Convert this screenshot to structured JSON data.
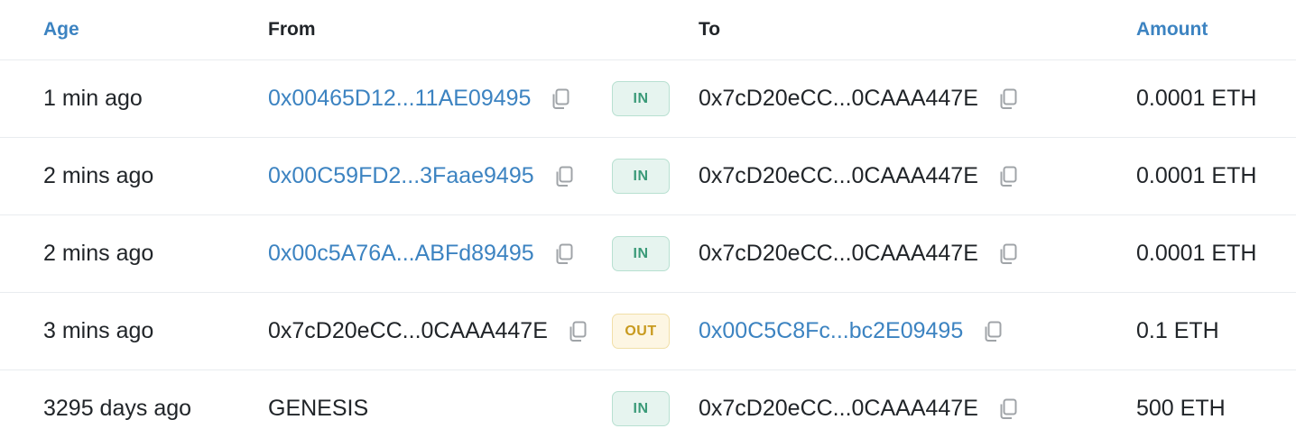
{
  "header": {
    "age": "Age",
    "from": "From",
    "to": "To",
    "amount": "Amount"
  },
  "rows": [
    {
      "age": "1 min ago",
      "from": "0x00465D12...11AE09495",
      "direction": "IN",
      "to": "0x7cD20eCC...0CAAA447E",
      "amount": "0.0001 ETH"
    },
    {
      "age": "2 mins ago",
      "from": "0x00C59FD2...3Faae9495",
      "direction": "IN",
      "to": "0x7cD20eCC...0CAAA447E",
      "amount": "0.0001 ETH"
    },
    {
      "age": "2 mins ago",
      "from": "0x00c5A76A...ABFd89495",
      "direction": "IN",
      "to": "0x7cD20eCC...0CAAA447E",
      "amount": "0.0001 ETH"
    },
    {
      "age": "3 mins ago",
      "from": "0x7cD20eCC...0CAAA447E",
      "direction": "OUT",
      "to": "0x00C5C8Fc...bc2E09495",
      "amount": "0.1 ETH"
    },
    {
      "age": "3295 days ago",
      "from": "GENESIS",
      "direction": "IN",
      "to": "0x7cD20eCC...0CAAA447E",
      "amount": "500 ETH"
    }
  ],
  "colors": {
    "link": "#3c83c1",
    "text": "#212529",
    "in_badge_bg": "#e6f4ef",
    "in_badge_text": "#3a9a78",
    "out_badge_bg": "#fdf6e3",
    "out_badge_text": "#c89a1e",
    "divider": "#e9ecef"
  }
}
